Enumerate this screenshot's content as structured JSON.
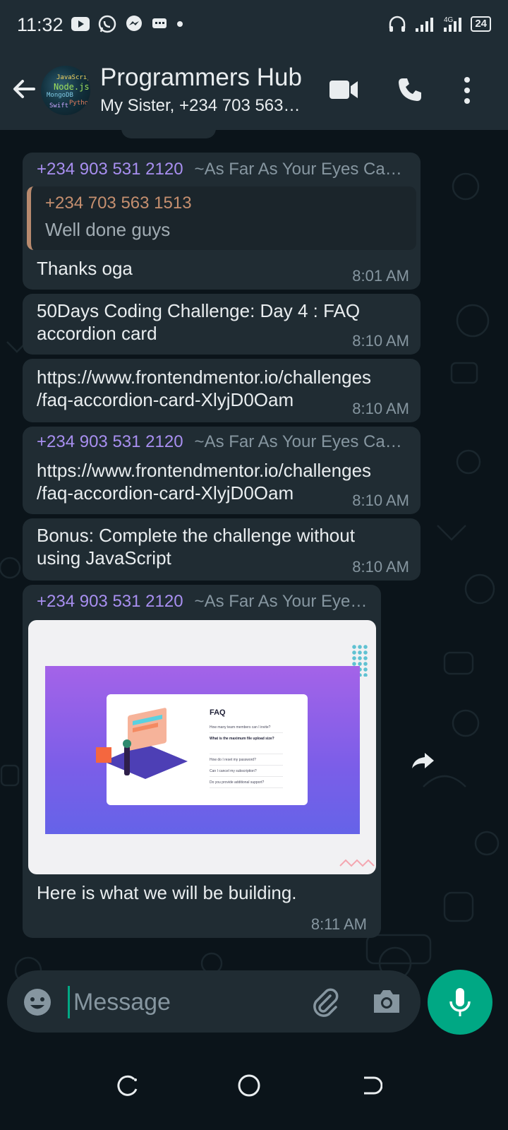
{
  "status_bar": {
    "time": "11:32",
    "network": "4G",
    "battery": "24"
  },
  "header": {
    "title": "Programmers Hub",
    "subtitle": "My Sister, +234 703 563…"
  },
  "messages": [
    {
      "sender_phone": "+234 903 531 2120",
      "sender_name": "~As Far As Your Eyes Ca…",
      "quote": {
        "author": "+234 703 563 1513",
        "text": "Well done guys"
      },
      "text": "Thanks oga",
      "time": "8:01 AM"
    },
    {
      "text_line1": "50Days Coding Challenge: Day 4 : FAQ",
      "text_line2": "accordion card",
      "time": "8:10 AM"
    },
    {
      "text_line1": "https://www.frontendmentor.io/challenges",
      "text_line2": "/faq-accordion-card-XlyjD0Oam",
      "time": "8:10 AM"
    },
    {
      "sender_phone": "+234 903 531 2120",
      "sender_name": "~As Far As Your Eyes Ca…",
      "text_line1": "https://www.frontendmentor.io/challenges",
      "text_line2": "/faq-accordion-card-XlyjD0Oam",
      "time": "8:10 AM"
    },
    {
      "text_line1": "Bonus: Complete the challenge without",
      "text_line2": "using JavaScript",
      "time": "8:10 AM"
    },
    {
      "sender_phone": "+234 903 531 2120",
      "sender_name": "~As Far As Your Eye…",
      "image": {
        "faq_title": "FAQ",
        "questions": [
          "How many team members can I invite?",
          "What is the maximum file upload size?",
          "How do I reset my password?",
          "Can I cancel my subscription?",
          "Do you provide additional support?"
        ]
      },
      "caption": "Here is what we will be building.",
      "time": "8:11 AM"
    }
  ],
  "input": {
    "placeholder": "Message"
  },
  "colors": {
    "accent": "#00a884",
    "sender": "#a88ff0",
    "bubble": "#202c33",
    "background": "#0b141a"
  }
}
